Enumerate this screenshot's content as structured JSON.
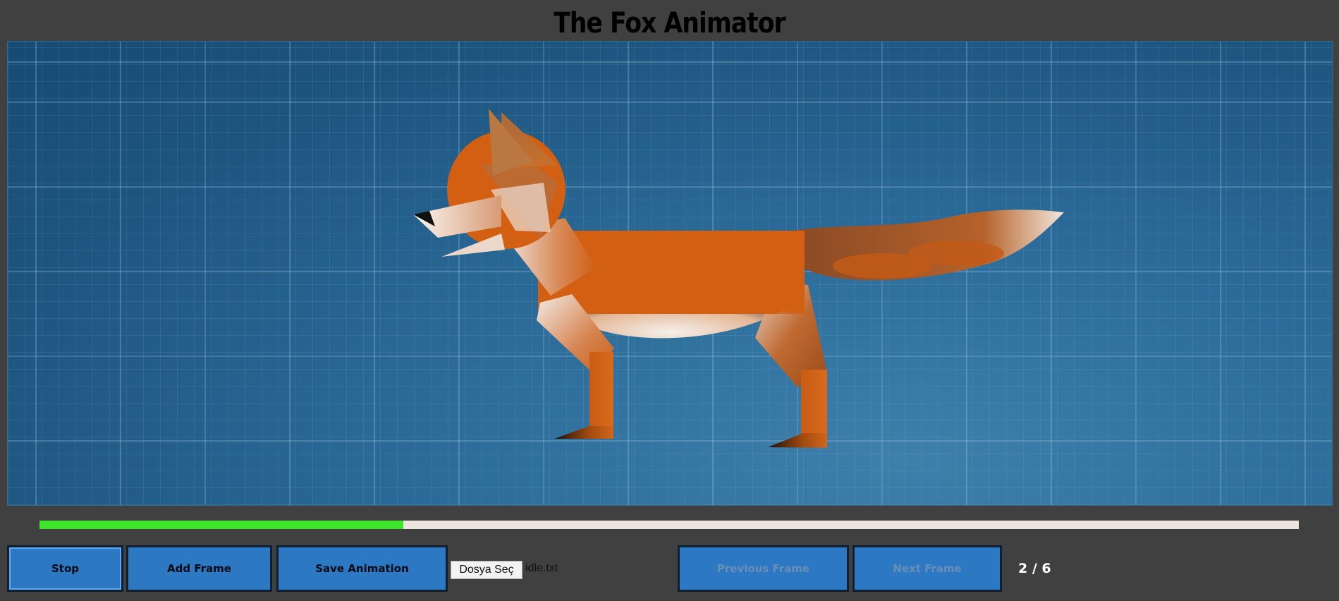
{
  "app": {
    "title": "The Fox Animator"
  },
  "playback": {
    "progress": 0.2888
  },
  "controls": {
    "stop_label": "Stop",
    "add_frame_label": "Add Frame",
    "save_animation_label": "Save Animation",
    "file_button_label": "Dosya Seç",
    "file_name": "idle.txt",
    "previous_frame_label": "Previous Frame",
    "next_frame_label": "Next Frame",
    "frame_counter": "2 / 6"
  },
  "colors": {
    "background": "#404040",
    "canvas_blue": "#2b6a98",
    "button_blue": "#2c78c3",
    "progress_green": "#3fe52a",
    "fox_orange": "#d25f12"
  }
}
